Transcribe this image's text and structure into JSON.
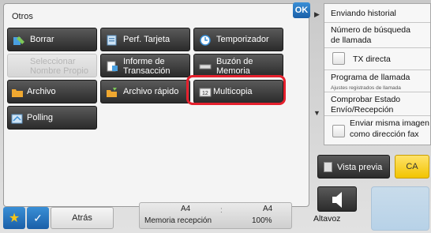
{
  "panel": {
    "title": "Otros",
    "ok_label": "OK"
  },
  "buttons": {
    "borrar": "Borrar",
    "perf_tarjeta": "Perf. Tarjeta",
    "temporizador": "Temporizador",
    "seleccionar_1": "Seleccionar",
    "seleccionar_2": "Nombre Propio",
    "informe_1": "Informe de",
    "informe_2": "Transacción",
    "buzon_1": "Buzón de",
    "buzon_2": "Memoria",
    "archivo": "Archivo",
    "archivo_rapido": "Archivo rápido",
    "multicopia": "Multicopia",
    "polling": "Polling"
  },
  "bottom": {
    "back_label": "Atrás",
    "paper_left": "A4",
    "paper_right": "A4",
    "memory_label": "Memoria recepción",
    "memory_value": "100%",
    "dots": ":"
  },
  "sidebar": {
    "item1": "Enviando historial",
    "item2_1": "Número de búsqueda",
    "item2_2": "de llamada",
    "item3": "TX directa",
    "item4": "Programa de llamada",
    "item4_sub": "Ajustes registrados de llamada",
    "item5_1": "Comprobar Estado",
    "item5_2": "Envío/Recepción",
    "item6_1": "Enviar misma imagen",
    "item6_2": "como dirección  fax"
  },
  "actions": {
    "preview_label": "Vista previa",
    "ca_label": "CA",
    "speaker_label": "Altavoz"
  },
  "colors": {
    "accent_blue": "#1a5fa8",
    "highlight_red": "#e5202d",
    "ca_yellow": "#f2c400"
  }
}
